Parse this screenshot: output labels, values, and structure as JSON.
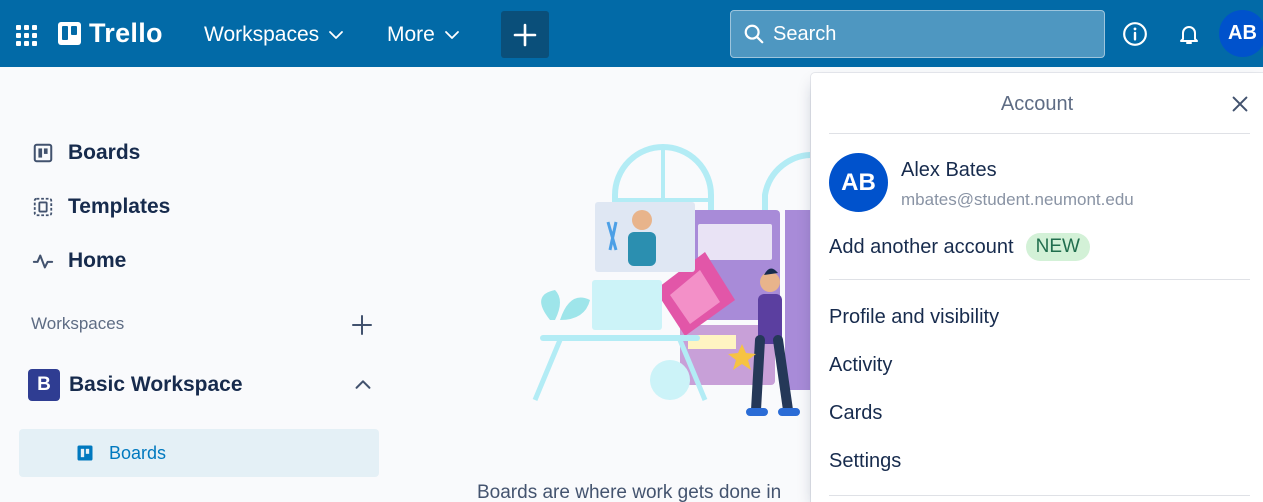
{
  "header": {
    "brand": "Trello",
    "nav": [
      {
        "label": "Workspaces"
      },
      {
        "label": "More"
      }
    ],
    "create_label": "+",
    "search_placeholder": "Search",
    "avatar_initials": "AB"
  },
  "sidebar": {
    "items": [
      {
        "label": "Boards",
        "icon": "board-icon"
      },
      {
        "label": "Templates",
        "icon": "template-icon"
      },
      {
        "label": "Home",
        "icon": "pulse-icon"
      }
    ],
    "workspaces_label": "Workspaces",
    "workspace": {
      "badge": "B",
      "name": "Basic Workspace",
      "sub_items": [
        {
          "label": "Boards"
        }
      ]
    }
  },
  "main": {
    "bottom_text": "Boards are where work gets done in"
  },
  "account_popover": {
    "title": "Account",
    "user": {
      "initials": "AB",
      "name": "Alex Bates",
      "email": "mbates@student.neumont.edu"
    },
    "add_account_label": "Add another account",
    "new_badge": "NEW",
    "menu": [
      {
        "label": "Profile and visibility"
      },
      {
        "label": "Activity"
      },
      {
        "label": "Cards"
      },
      {
        "label": "Settings"
      }
    ]
  },
  "colors": {
    "header_bg": "#026aa7",
    "avatar": "#0052cc",
    "workspace_badge": "#2f3d92",
    "active_bg": "#e4f0f6",
    "active_text": "#0079bf",
    "new_badge_bg": "#d3f1d7"
  }
}
